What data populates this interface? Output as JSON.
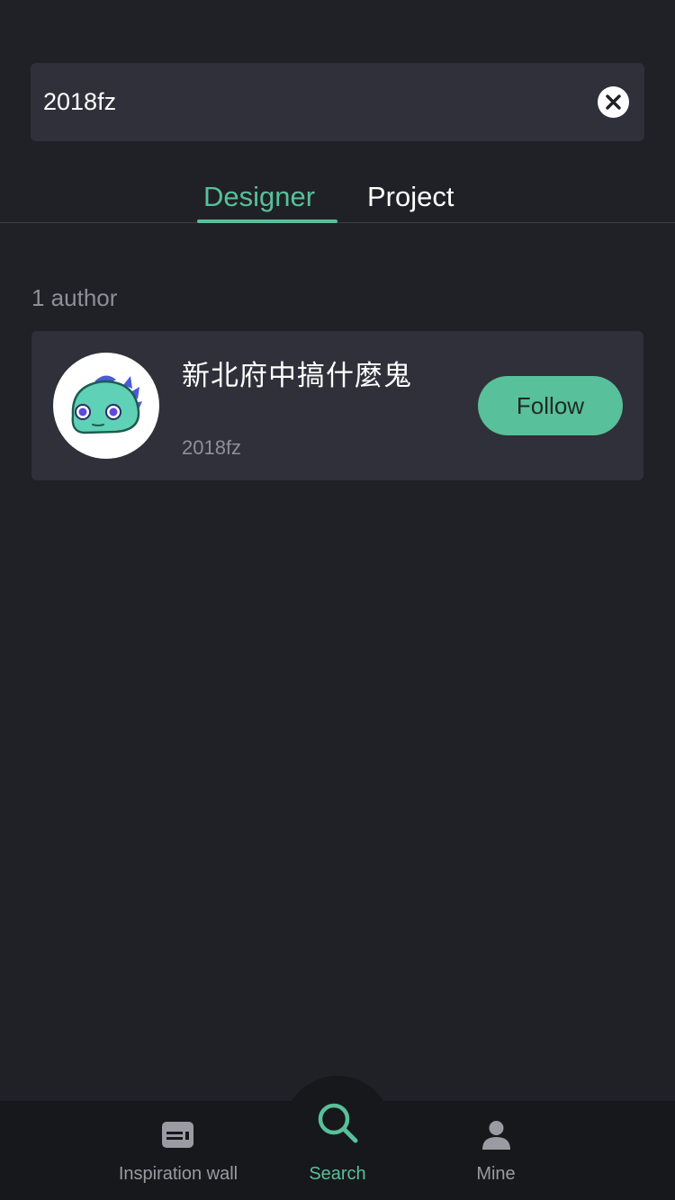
{
  "search": {
    "query": "2018fz",
    "clear_icon": "close-icon"
  },
  "tabs": [
    {
      "label": "Designer",
      "active": true
    },
    {
      "label": "Project",
      "active": false
    }
  ],
  "results": {
    "count_label": "1 author",
    "authors": [
      {
        "name": "新北府中搞什麼鬼",
        "id": "2018fz",
        "avatar_icon": "dino-avatar",
        "follow_label": "Follow"
      }
    ]
  },
  "bottom_nav": {
    "items": [
      {
        "label": "Inspiration wall",
        "icon": "news-card-icon",
        "active": false
      },
      {
        "label": "Search",
        "icon": "search-icon",
        "active": true
      },
      {
        "label": "Mine",
        "icon": "person-icon",
        "active": false
      }
    ]
  },
  "colors": {
    "accent": "#58c09a",
    "background": "#202126",
    "card": "#2f3039",
    "nav": "#17181b",
    "muted_text": "#8e8f98"
  }
}
